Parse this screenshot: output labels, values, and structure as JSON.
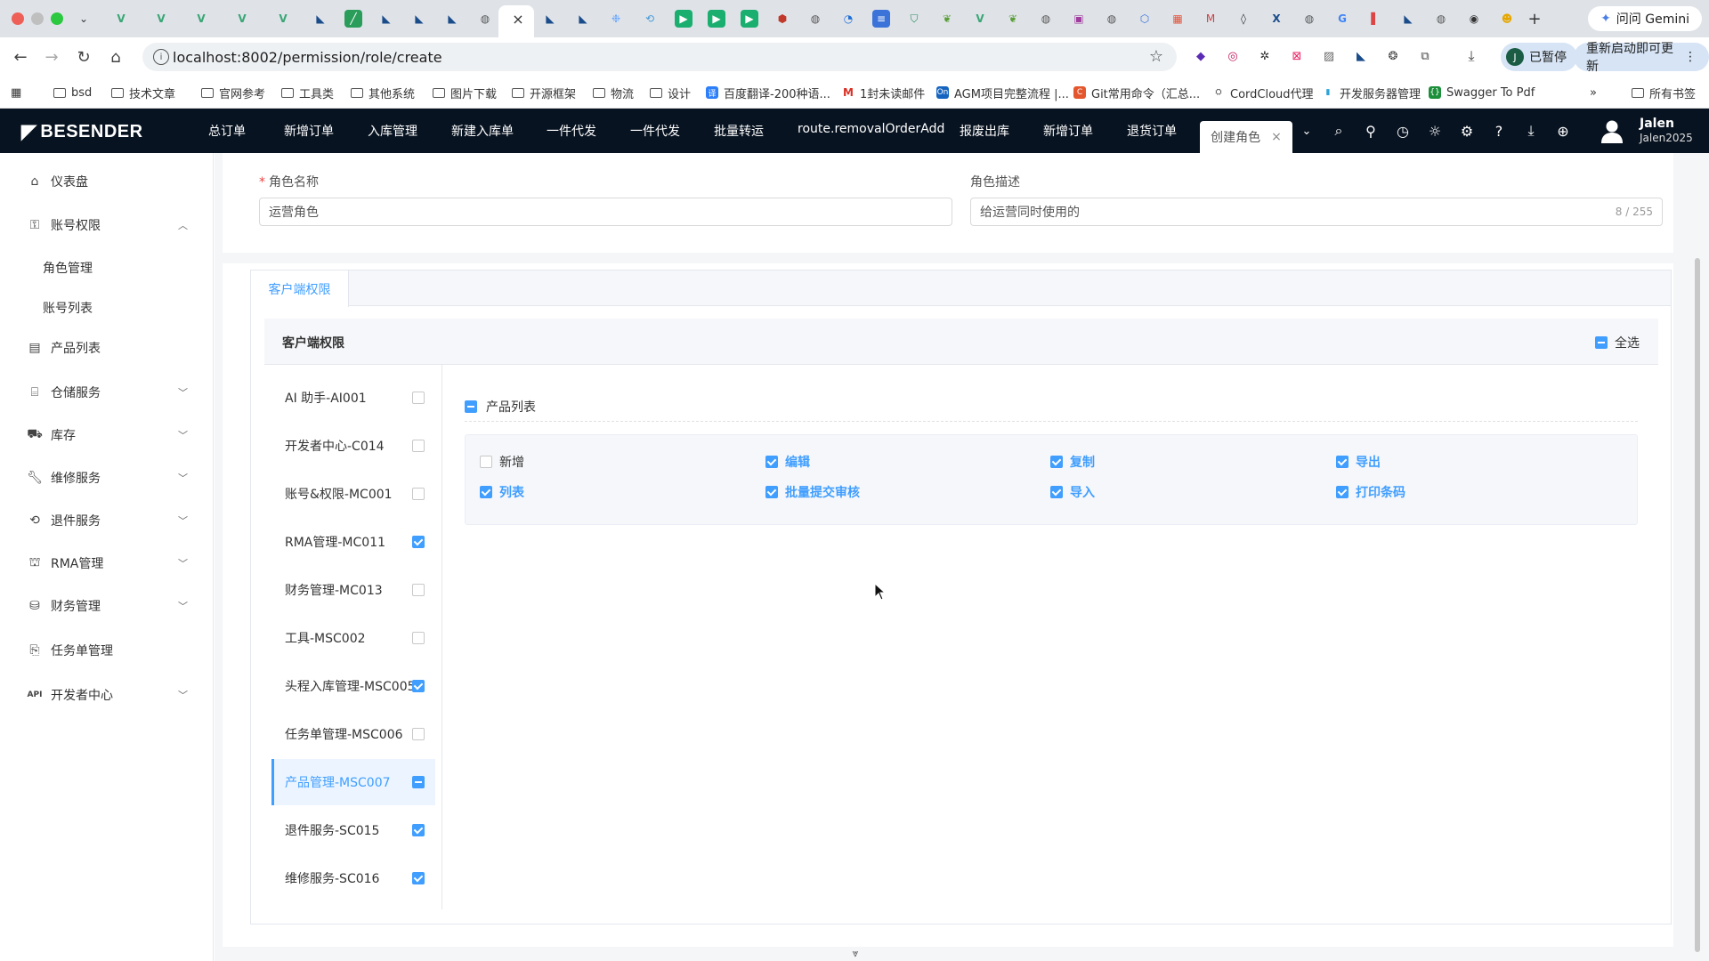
{
  "browser": {
    "url": "localhost:8002/permission/role/create",
    "gemini_label": "问问 Gemini",
    "pause_label": "已暂停",
    "pause_avatar": "J",
    "restart_label": "重新启动即可更新",
    "bookmarks": [
      "bsd",
      "技术文章",
      "官网参考",
      "工具类",
      "其他系统",
      "图片下载",
      "开源框架",
      "物流",
      "设计",
      "百度翻译-200种语...",
      "1封未读邮件",
      "AGM项目完整流程 |...",
      "Git常用命令（汇总...",
      "CordCloud代理",
      "开发服务器管理",
      "Swagger To Pdf"
    ],
    "all_bookmarks_label": "所有书签"
  },
  "app": {
    "logo": "BESENDER",
    "nav": [
      "总订单",
      "新增订单",
      "入库管理",
      "新建入库单",
      "一件代发",
      "一件代发",
      "批量转运",
      "route.removalOrderAdd",
      "报废出库",
      "新增订单",
      "退货订单"
    ],
    "active_tab": "创建角色",
    "user": {
      "name": "Jalen",
      "id": "Jalen2025"
    }
  },
  "sidebar": {
    "items": [
      {
        "label": "仪表盘",
        "icon": "home-icon"
      },
      {
        "label": "账号权限",
        "icon": "user-key-icon",
        "expanded": true
      },
      {
        "label": "产品列表",
        "icon": "product-icon"
      },
      {
        "label": "仓储服务",
        "icon": "warehouse-icon"
      },
      {
        "label": "库存",
        "icon": "stock-icon"
      },
      {
        "label": "维修服务",
        "icon": "wrench-icon"
      },
      {
        "label": "退件服务",
        "icon": "return-icon"
      },
      {
        "label": "RMA管理",
        "icon": "rma-icon"
      },
      {
        "label": "财务管理",
        "icon": "finance-icon"
      },
      {
        "label": "任务单管理",
        "icon": "task-icon"
      },
      {
        "label": "开发者中心",
        "icon": "api-icon"
      }
    ],
    "sub_items": [
      "角色管理",
      "账号列表"
    ],
    "api_tag": "API"
  },
  "form": {
    "role_name_label": "角色名称",
    "role_name_value": "运营角色",
    "role_desc_label": "角色描述",
    "role_desc_value": "给运营同时使用的",
    "role_desc_counter": "8 / 255"
  },
  "permissions": {
    "tab_label": "客户端权限",
    "section_title": "客户端权限",
    "select_all_label": "全选",
    "modules": [
      {
        "label": "AI 助手-AI001",
        "state": "off"
      },
      {
        "label": "开发者中心-C014",
        "state": "off"
      },
      {
        "label": "账号&权限-MC001",
        "state": "off"
      },
      {
        "label": "RMA管理-MC011",
        "state": "on"
      },
      {
        "label": "财务管理-MC013",
        "state": "off"
      },
      {
        "label": "工具-MSC002",
        "state": "off"
      },
      {
        "label": "头程入库管理-MSC005",
        "state": "on"
      },
      {
        "label": "任务单管理-MSC006",
        "state": "off"
      },
      {
        "label": "产品管理-MSC007",
        "state": "ind",
        "active": true
      },
      {
        "label": "退件服务-SC015",
        "state": "on"
      },
      {
        "label": "维修服务-SC016",
        "state": "on"
      }
    ],
    "group_label": "产品列表",
    "operations": [
      {
        "label": "新增",
        "checked": false
      },
      {
        "label": "编辑",
        "checked": true
      },
      {
        "label": "复制",
        "checked": true
      },
      {
        "label": "导出",
        "checked": true
      },
      {
        "label": "列表",
        "checked": true
      },
      {
        "label": "批量提交审核",
        "checked": true
      },
      {
        "label": "导入",
        "checked": true
      },
      {
        "label": "打印条码",
        "checked": true
      }
    ]
  }
}
